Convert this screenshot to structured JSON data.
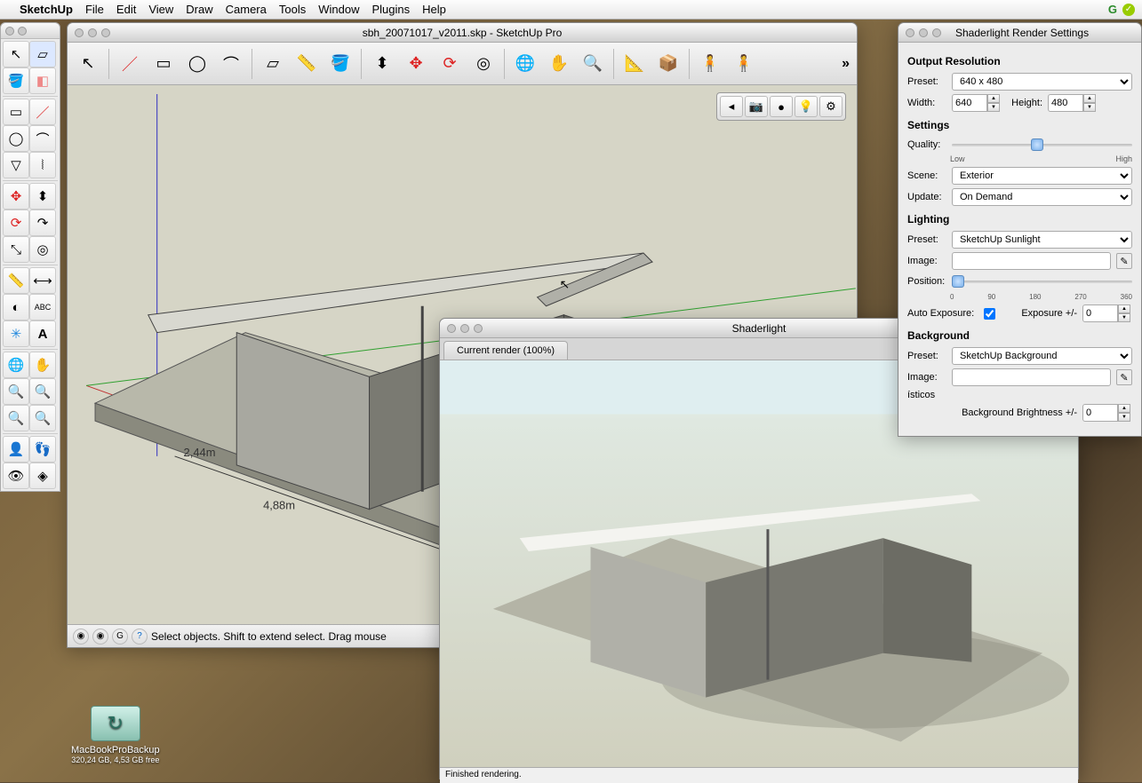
{
  "menubar": {
    "app": "SketchUp",
    "items": [
      "File",
      "Edit",
      "View",
      "Draw",
      "Camera",
      "Tools",
      "Window",
      "Plugins",
      "Help"
    ]
  },
  "mainwin": {
    "title": "sbh_20071017_v2011.skp - SketchUp Pro",
    "status": "Select objects. Shift to extend select. Drag mouse",
    "dim1": "2,44m",
    "dim2": "4,88m"
  },
  "renderwin": {
    "title": "Shaderlight",
    "tab": "Current render (100%)",
    "status": "Finished rendering."
  },
  "settings": {
    "title": "Shaderlight Render Settings",
    "section_output": "Output Resolution",
    "preset_label": "Preset:",
    "preset_value": "640 x 480",
    "width_label": "Width:",
    "width_value": "640",
    "height_label": "Height:",
    "height_value": "480",
    "section_settings": "Settings",
    "quality_label": "Quality:",
    "quality_low": "Low",
    "quality_high": "High",
    "scene_label": "Scene:",
    "scene_value": "Exterior",
    "update_label": "Update:",
    "update_value": "On Demand",
    "section_lighting": "Lighting",
    "lpreset_value": "SketchUp Sunlight",
    "image_label": "Image:",
    "position_label": "Position:",
    "pos0": "0",
    "pos1": "90",
    "pos2": "180",
    "pos3": "270",
    "pos4": "360",
    "autoexp_label": "Auto Exposure:",
    "exposure_label": "Exposure +/-",
    "exposure_value": "0",
    "section_bg": "Background",
    "bgpreset_value": "SketchUp Background",
    "bgbright_label": "Background Brightness +/-",
    "bgbright_value": "0"
  },
  "desktop": {
    "icon_name": "MacBookProBackup",
    "icon_sub": "320,24 GB, 4,53 GB free"
  }
}
